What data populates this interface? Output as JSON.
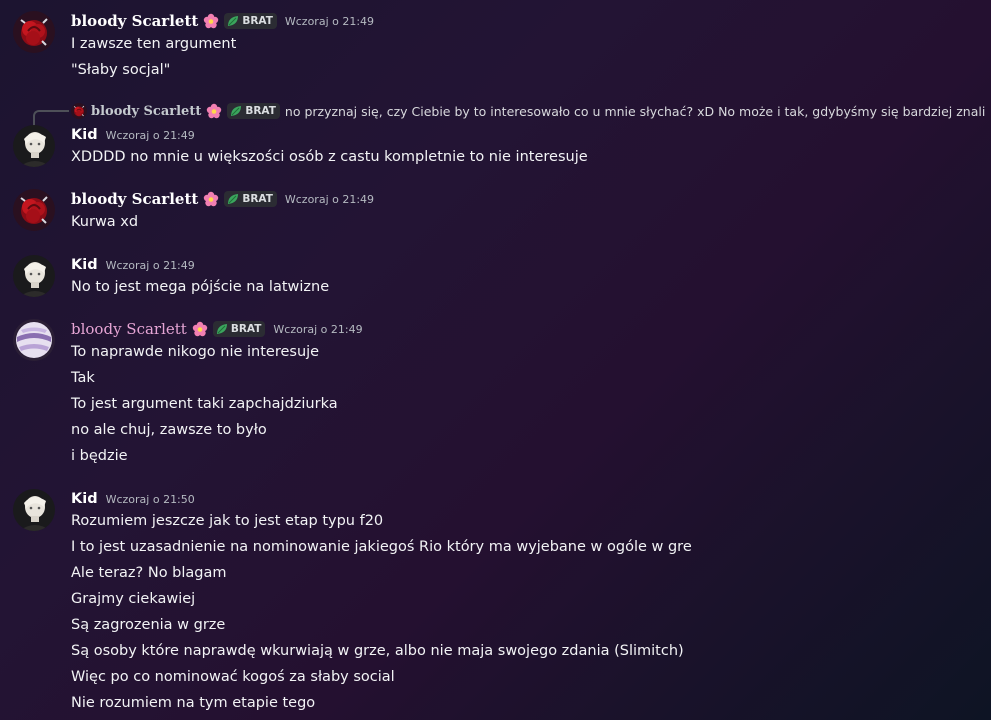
{
  "messages": [
    {
      "author": "bloody Scarlett",
      "badge": "BRAT",
      "time": "Wczoraj o 21:49",
      "lines": [
        "I zawsze ten argument",
        "\"Słaby socjal\""
      ]
    },
    {
      "reply": {
        "author": "bloody Scarlett",
        "badge": "BRAT",
        "text": "no przyznaj się, czy Ciebie by to interesowało co u mnie słychać? xD No może i tak, gdybyśmy się bardziej znali"
      },
      "author": "Kid",
      "time": "Wczoraj o 21:49",
      "lines": [
        "XDDDD no mnie u większości osób z castu kompletnie to nie interesuje"
      ]
    },
    {
      "author": "bloody Scarlett",
      "badge": "BRAT",
      "time": "Wczoraj o 21:49",
      "lines": [
        "Kurwa xd"
      ]
    },
    {
      "author": "Kid",
      "time": "Wczoraj o 21:49",
      "lines": [
        "No to jest mega pójście na latwizne"
      ]
    },
    {
      "author": "bloody Scarlett",
      "badge": "BRAT",
      "time": "Wczoraj o 21:49",
      "lines": [
        "To naprawde nikogo nie interesuje",
        "Tak",
        "To jest argument taki zapchajdziurka",
        "no ale chuj, zawsze to było",
        "i będzie"
      ]
    },
    {
      "author": "Kid",
      "time": "Wczoraj o 21:50",
      "lines": [
        "Rozumiem jeszcze jak to jest etap typu f20",
        "I to jest uzasadnienie na nominowanie jakiegoś Rio który ma wyjebane w ogóle w gre",
        "Ale teraz? No blagam",
        "Grajmy ciekawiej",
        "Są zagrozenia w grze",
        "Są osoby które naprawdę wkurwiają w grze, albo nie maja swojego zdania (Slimitch)",
        "Więc po co nominować kogoś za słaby social",
        "Nie rozumiem na tym etapie tego"
      ]
    }
  ],
  "colors": {
    "name_default": "#ffffff",
    "name_gradient": "#e5a4d4",
    "timestamp": "#b5bac1",
    "message_text": "#f2f3f5",
    "badge_bg": "#2b2c33",
    "leaf": "#3ba55d"
  },
  "icons": {
    "avatar_scarlett": "red-rose-avatar-icon",
    "avatar_scarlett_alt": "swirl-sphere-avatar-icon",
    "avatar_kid": "portrait-avatar-icon",
    "flower": "pink-flower-icon",
    "leaf": "leaf-icon"
  }
}
